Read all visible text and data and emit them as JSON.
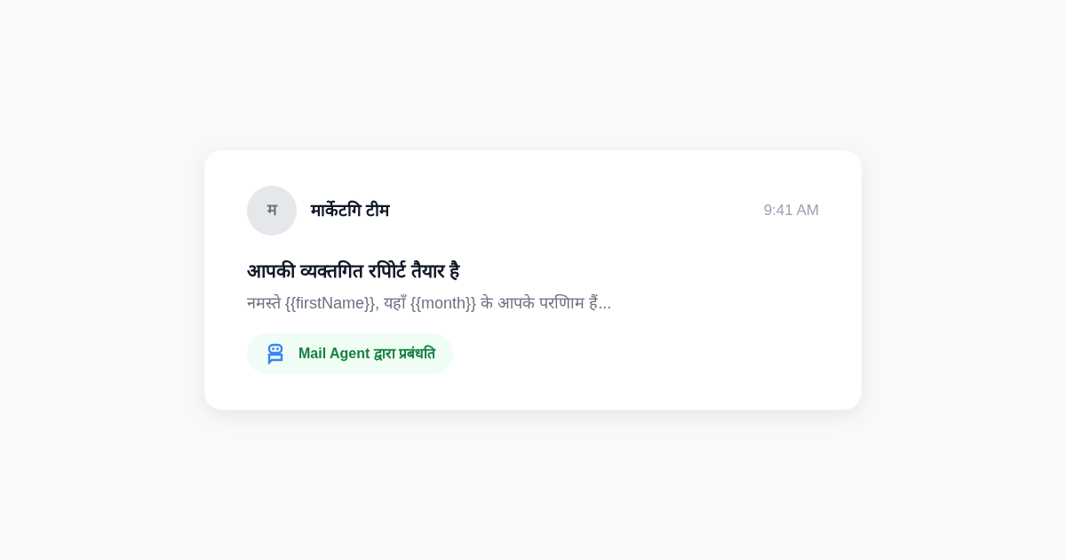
{
  "message": {
    "avatar": "म",
    "sender": "मार्केटगि टीम",
    "time": "9:41 AM",
    "subject": "आपकी व्यक्तगित रपिोर्ट तैयार है",
    "preview": "नमस्ते {{firstName}}, यहाँ {{month}} के आपके परणािम हैं...",
    "badge": {
      "label": "Mail Agent द्वारा प्रबंधति"
    }
  }
}
